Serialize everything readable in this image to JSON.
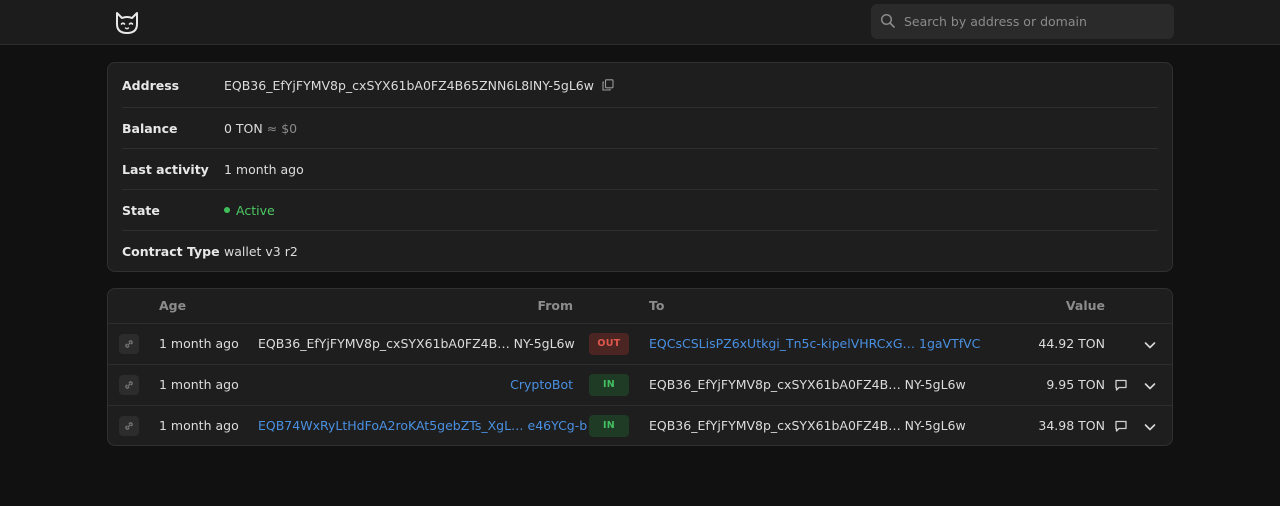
{
  "header": {
    "logo": "cat-logo-icon",
    "search": {
      "placeholder": "Search by address or domain",
      "value": ""
    }
  },
  "account": {
    "address_label": "Address",
    "address": "EQB36_EfYjFYMV8p_cxSYX61bA0FZ4B65ZNN6L8INY-5gL6w",
    "balance_label": "Balance",
    "balance": "0 TON",
    "balance_fiat": "≈ $0",
    "last_activity_label": "Last activity",
    "last_activity": "1 month ago",
    "state_label": "State",
    "state": "Active",
    "contract_type_label": "Contract Type",
    "contract_type": "wallet v3 r2"
  },
  "transactions": {
    "columns": {
      "age": "Age",
      "from": "From",
      "to": "To",
      "value": "Value"
    },
    "rows": [
      {
        "age": "1 month ago",
        "from": "EQB36_EfYjFYMV8p_cxSYX61bA0FZ4B… NY-5gL6w",
        "direction": "OUT",
        "to": "EQCsCSLisPZ6xUtkgi_Tn5c-kipelVHRCxG… 1gaVTfVC",
        "value": "44.92 TON"
      },
      {
        "age": "1 month ago",
        "from": "CryptoBot",
        "direction": "IN",
        "to": "EQB36_EfYjFYMV8p_cxSYX61bA0FZ4B… NY-5gL6w",
        "value": "9.95 TON"
      },
      {
        "age": "1 month ago",
        "from": "EQB74WxRyLtHdFoA2roKAt5gebZTs_XgL… e46YCg-b",
        "direction": "IN",
        "to": "EQB36_EfYjFYMV8p_cxSYX61bA0FZ4B… NY-5gL6w",
        "value": "34.98 TON"
      }
    ]
  },
  "colors": {
    "link": "#4a90e2",
    "active": "#4cc964",
    "out_badge": "#e0584e",
    "in_badge": "#45c060"
  }
}
